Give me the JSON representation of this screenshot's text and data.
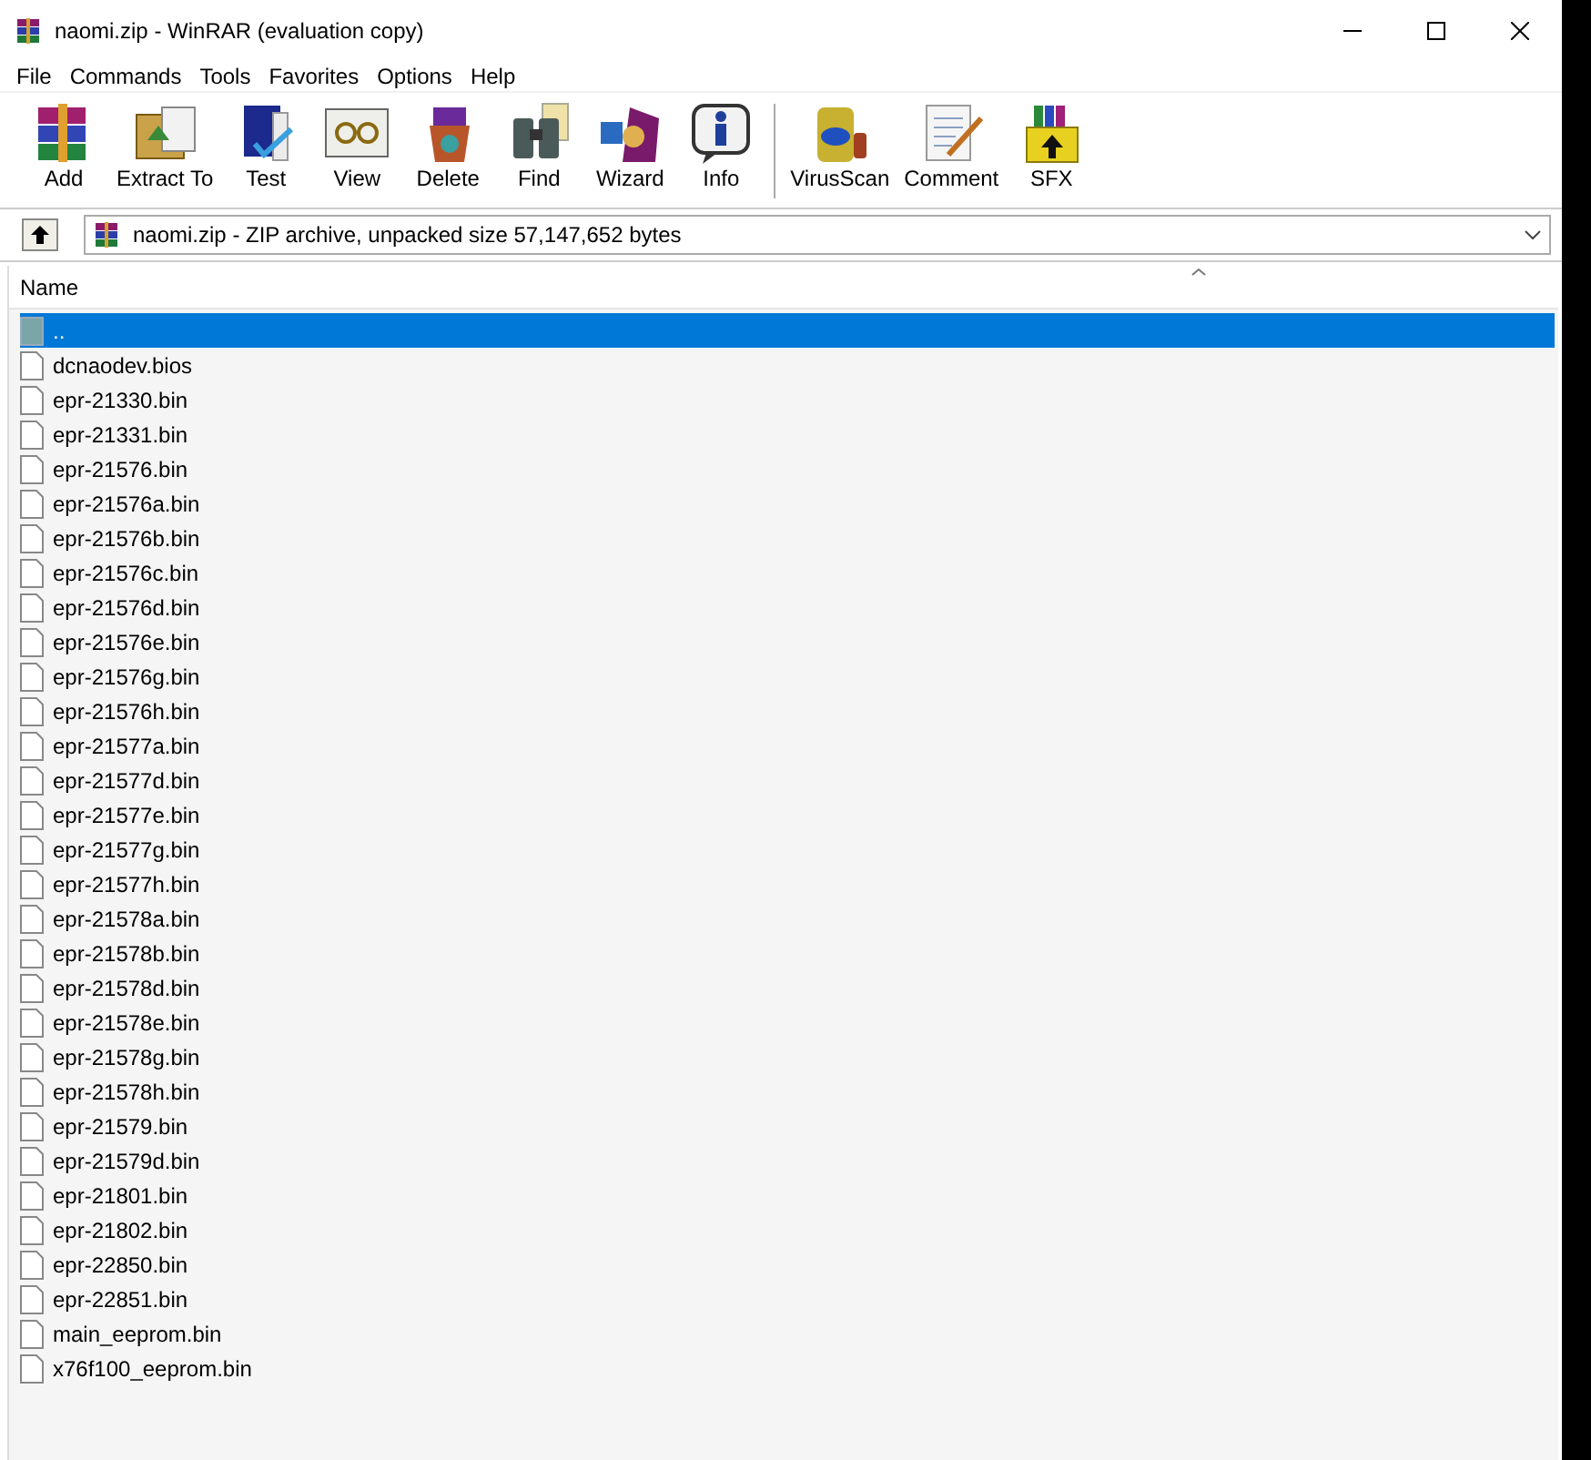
{
  "window": {
    "title": "naomi.zip - WinRAR (evaluation copy)"
  },
  "menu": [
    "File",
    "Commands",
    "Tools",
    "Favorites",
    "Options",
    "Help"
  ],
  "toolbar": [
    {
      "label": "Add",
      "kind": "add"
    },
    {
      "label": "Extract To",
      "kind": "extract"
    },
    {
      "label": "Test",
      "kind": "test"
    },
    {
      "label": "View",
      "kind": "view"
    },
    {
      "label": "Delete",
      "kind": "delete"
    },
    {
      "label": "Find",
      "kind": "find"
    },
    {
      "label": "Wizard",
      "kind": "wizard"
    },
    {
      "label": "Info",
      "kind": "info"
    },
    {
      "label": "VirusScan",
      "kind": "virus"
    },
    {
      "label": "Comment",
      "kind": "comment"
    },
    {
      "label": "SFX",
      "kind": "sfx"
    }
  ],
  "address": {
    "value": "naomi.zip - ZIP archive, unpacked size 57,147,652 bytes"
  },
  "table": {
    "columns": [
      "Name"
    ],
    "rows": [
      {
        "name": "..",
        "kind": "parent",
        "selected": true
      },
      {
        "name": "dcnaodev.bios",
        "kind": "file",
        "selected": false
      },
      {
        "name": "epr-21330.bin",
        "kind": "file",
        "selected": false
      },
      {
        "name": "epr-21331.bin",
        "kind": "file",
        "selected": false
      },
      {
        "name": "epr-21576.bin",
        "kind": "file",
        "selected": false
      },
      {
        "name": "epr-21576a.bin",
        "kind": "file",
        "selected": false
      },
      {
        "name": "epr-21576b.bin",
        "kind": "file",
        "selected": false
      },
      {
        "name": "epr-21576c.bin",
        "kind": "file",
        "selected": false
      },
      {
        "name": "epr-21576d.bin",
        "kind": "file",
        "selected": false
      },
      {
        "name": "epr-21576e.bin",
        "kind": "file",
        "selected": false
      },
      {
        "name": "epr-21576g.bin",
        "kind": "file",
        "selected": false
      },
      {
        "name": "epr-21576h.bin",
        "kind": "file",
        "selected": false
      },
      {
        "name": "epr-21577a.bin",
        "kind": "file",
        "selected": false
      },
      {
        "name": "epr-21577d.bin",
        "kind": "file",
        "selected": false
      },
      {
        "name": "epr-21577e.bin",
        "kind": "file",
        "selected": false
      },
      {
        "name": "epr-21577g.bin",
        "kind": "file",
        "selected": false
      },
      {
        "name": "epr-21577h.bin",
        "kind": "file",
        "selected": false
      },
      {
        "name": "epr-21578a.bin",
        "kind": "file",
        "selected": false
      },
      {
        "name": "epr-21578b.bin",
        "kind": "file",
        "selected": false
      },
      {
        "name": "epr-21578d.bin",
        "kind": "file",
        "selected": false
      },
      {
        "name": "epr-21578e.bin",
        "kind": "file",
        "selected": false
      },
      {
        "name": "epr-21578g.bin",
        "kind": "file",
        "selected": false
      },
      {
        "name": "epr-21578h.bin",
        "kind": "file",
        "selected": false
      },
      {
        "name": "epr-21579.bin",
        "kind": "file",
        "selected": false
      },
      {
        "name": "epr-21579d.bin",
        "kind": "file",
        "selected": false
      },
      {
        "name": "epr-21801.bin",
        "kind": "file",
        "selected": false
      },
      {
        "name": "epr-21802.bin",
        "kind": "file",
        "selected": false
      },
      {
        "name": "epr-22850.bin",
        "kind": "file",
        "selected": false
      },
      {
        "name": "epr-22851.bin",
        "kind": "file",
        "selected": false
      },
      {
        "name": "main_eeprom.bin",
        "kind": "file",
        "selected": false
      },
      {
        "name": "x76f100_eeprom.bin",
        "kind": "file",
        "selected": false
      }
    ]
  }
}
